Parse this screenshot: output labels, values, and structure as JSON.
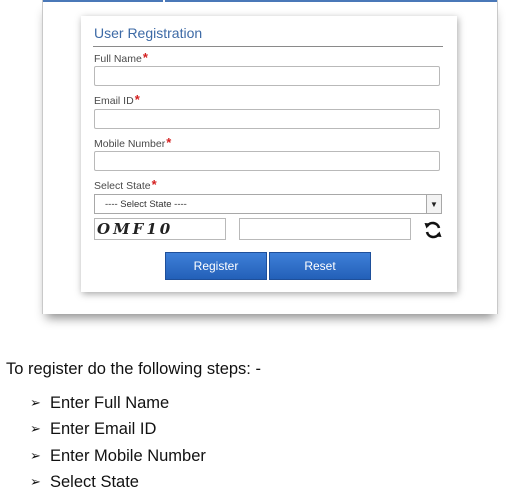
{
  "form": {
    "title": "User Registration",
    "full_name_label": "Full Name",
    "email_label": "Email ID",
    "mobile_label": "Mobile Number",
    "state_label": "Select State",
    "required_mark": "*",
    "full_name_value": "",
    "email_value": "",
    "mobile_value": "",
    "state_selected": "---- Select State ----",
    "captcha_text": "OMF10",
    "captcha_input_value": "",
    "register_label": "Register",
    "reset_label": "Reset"
  },
  "instructions": {
    "intro": "To register do the following steps: -",
    "bullet_glyph": "➢",
    "steps": [
      "Enter Full Name",
      "Enter Email ID",
      "Enter Mobile Number",
      "Select State"
    ]
  },
  "colors": {
    "title_blue": "#3d6aa6",
    "required_red": "#d42020",
    "button_blue": "#2f6fca"
  },
  "icons": {
    "refresh": "refresh-icon",
    "dropdown": "chevron-down-icon"
  }
}
